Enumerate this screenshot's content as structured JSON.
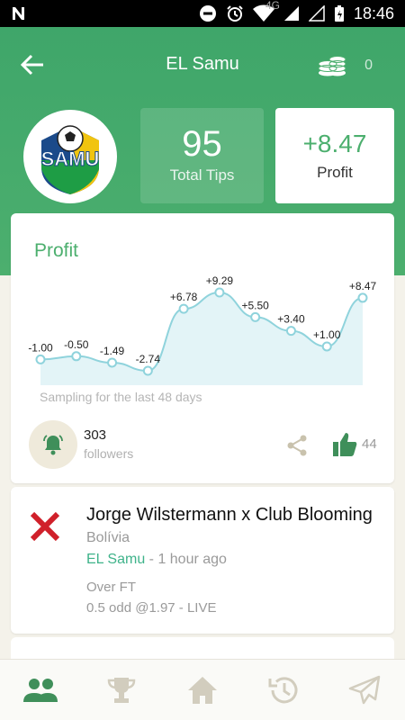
{
  "status_bar": {
    "time": "18:46",
    "network": "4G"
  },
  "header": {
    "title": "EL Samu",
    "coins": "0"
  },
  "profile": {
    "avatar_text": "SAMU"
  },
  "stats": {
    "total_tips_value": "95",
    "total_tips_label": "Total Tips",
    "profit_value": "+8.47",
    "profit_label": "Profit"
  },
  "profit_card": {
    "title": "Profit",
    "note": "Sampling for the last 48 days",
    "followers_count": "303",
    "followers_label": "followers",
    "likes": "44"
  },
  "chart_data": {
    "type": "area",
    "values": [
      -1.0,
      -0.5,
      -1.49,
      -2.74,
      6.78,
      9.29,
      5.5,
      3.4,
      1.0,
      8.47
    ],
    "labels": [
      "-1.00",
      "-0.50",
      "-1.49",
      "-2.74",
      "+6.78",
      "+9.29",
      "+5.50",
      "+3.40",
      "+1.00",
      "+8.47"
    ],
    "ylim": [
      -2.74,
      9.29
    ],
    "grid": false,
    "colors": {
      "line": "#8fd3dc",
      "fill": "#e3f4f7",
      "point": "#8fd3dc"
    }
  },
  "tip": {
    "result": "lost",
    "title": "Jorge Wilstermann x Club Blooming",
    "country": "Bolívia",
    "tipster": "EL Samu",
    "time_ago": " - 1 hour ago",
    "market": "Over FT",
    "odd_line": "0.5 odd @1.97 - LIVE"
  },
  "nav": {
    "items": [
      "people-icon",
      "trophy-icon",
      "home-icon",
      "history-icon",
      "send-icon"
    ]
  },
  "colors": {
    "brand": "#4caf6e",
    "lost": "#d0202a",
    "accent_link": "#3fb38a"
  }
}
